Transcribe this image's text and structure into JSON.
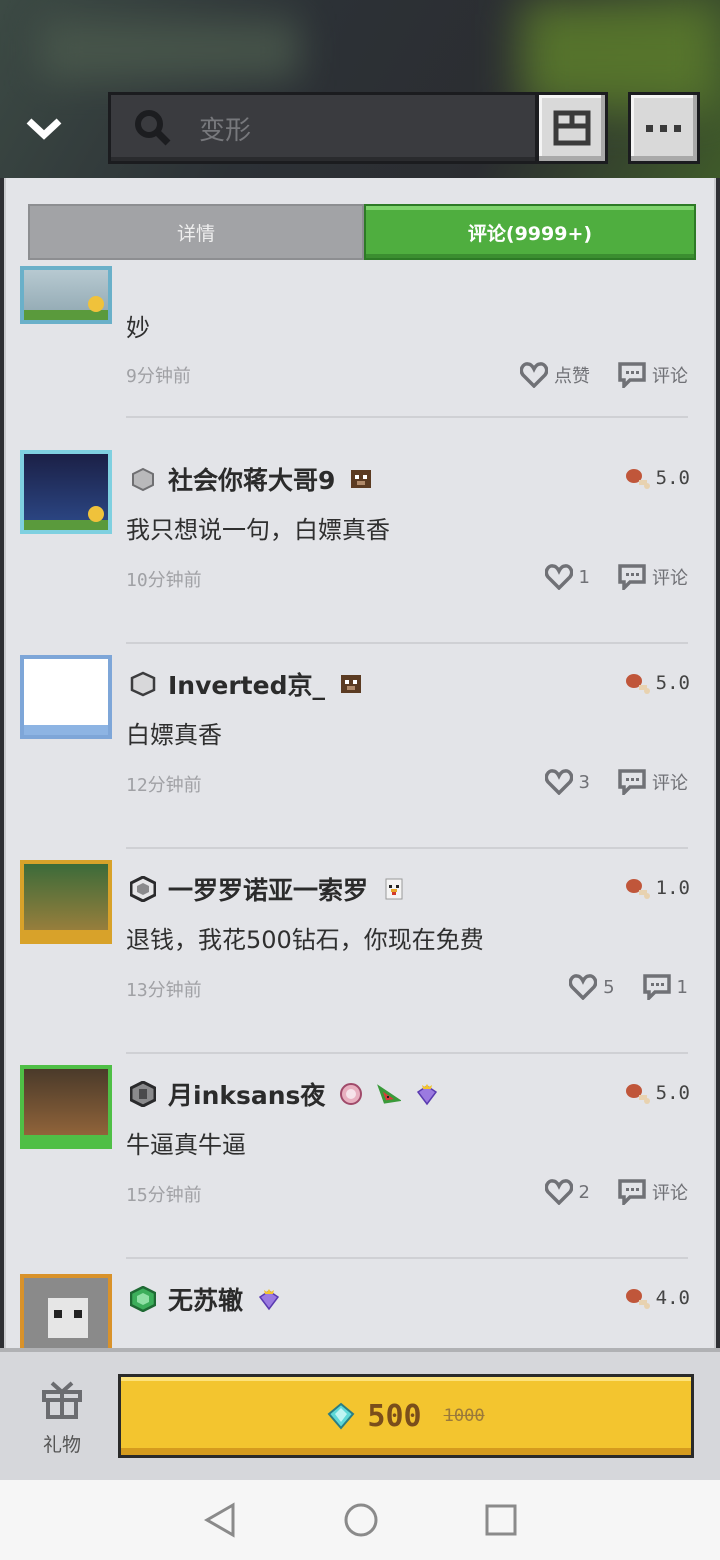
{
  "header": {
    "search_placeholder": "变形"
  },
  "tabs": [
    {
      "label": "详情",
      "active": false
    },
    {
      "label": "评论(9999+)",
      "active": true
    }
  ],
  "comments": [
    {
      "username": "",
      "text": "妙",
      "time": "9分钟前",
      "rating": "",
      "likes": "点赞",
      "reply": "评论"
    },
    {
      "username": "社会你蒋大哥9",
      "text": "我只想说一句，白嫖真香",
      "time": "10分钟前",
      "rating": "5.0",
      "likes": "1",
      "reply": "评论"
    },
    {
      "username": "Inverted京_",
      "text": "白嫖真香",
      "time": "12分钟前",
      "rating": "5.0",
      "likes": "3",
      "reply": "评论"
    },
    {
      "username": "一罗罗诺亚一索罗",
      "text": "退钱，我花500钻石，你现在免费",
      "time": "13分钟前",
      "rating": "1.0",
      "likes": "5",
      "reply": "1"
    },
    {
      "username": "月inksans夜",
      "text": "牛逼真牛逼",
      "time": "15分钟前",
      "rating": "5.0",
      "likes": "2",
      "reply": "评论"
    },
    {
      "username": "无苏辙",
      "text": "",
      "time": "",
      "rating": "4.0",
      "likes": "",
      "reply": ""
    }
  ],
  "bottom": {
    "gift_label": "礼物",
    "price": "500",
    "old_price": "1000"
  },
  "colors": {
    "accent_green": "#4fae3f",
    "buy_yellow": "#f3c52f",
    "panel_bg": "#e3e4e8"
  }
}
